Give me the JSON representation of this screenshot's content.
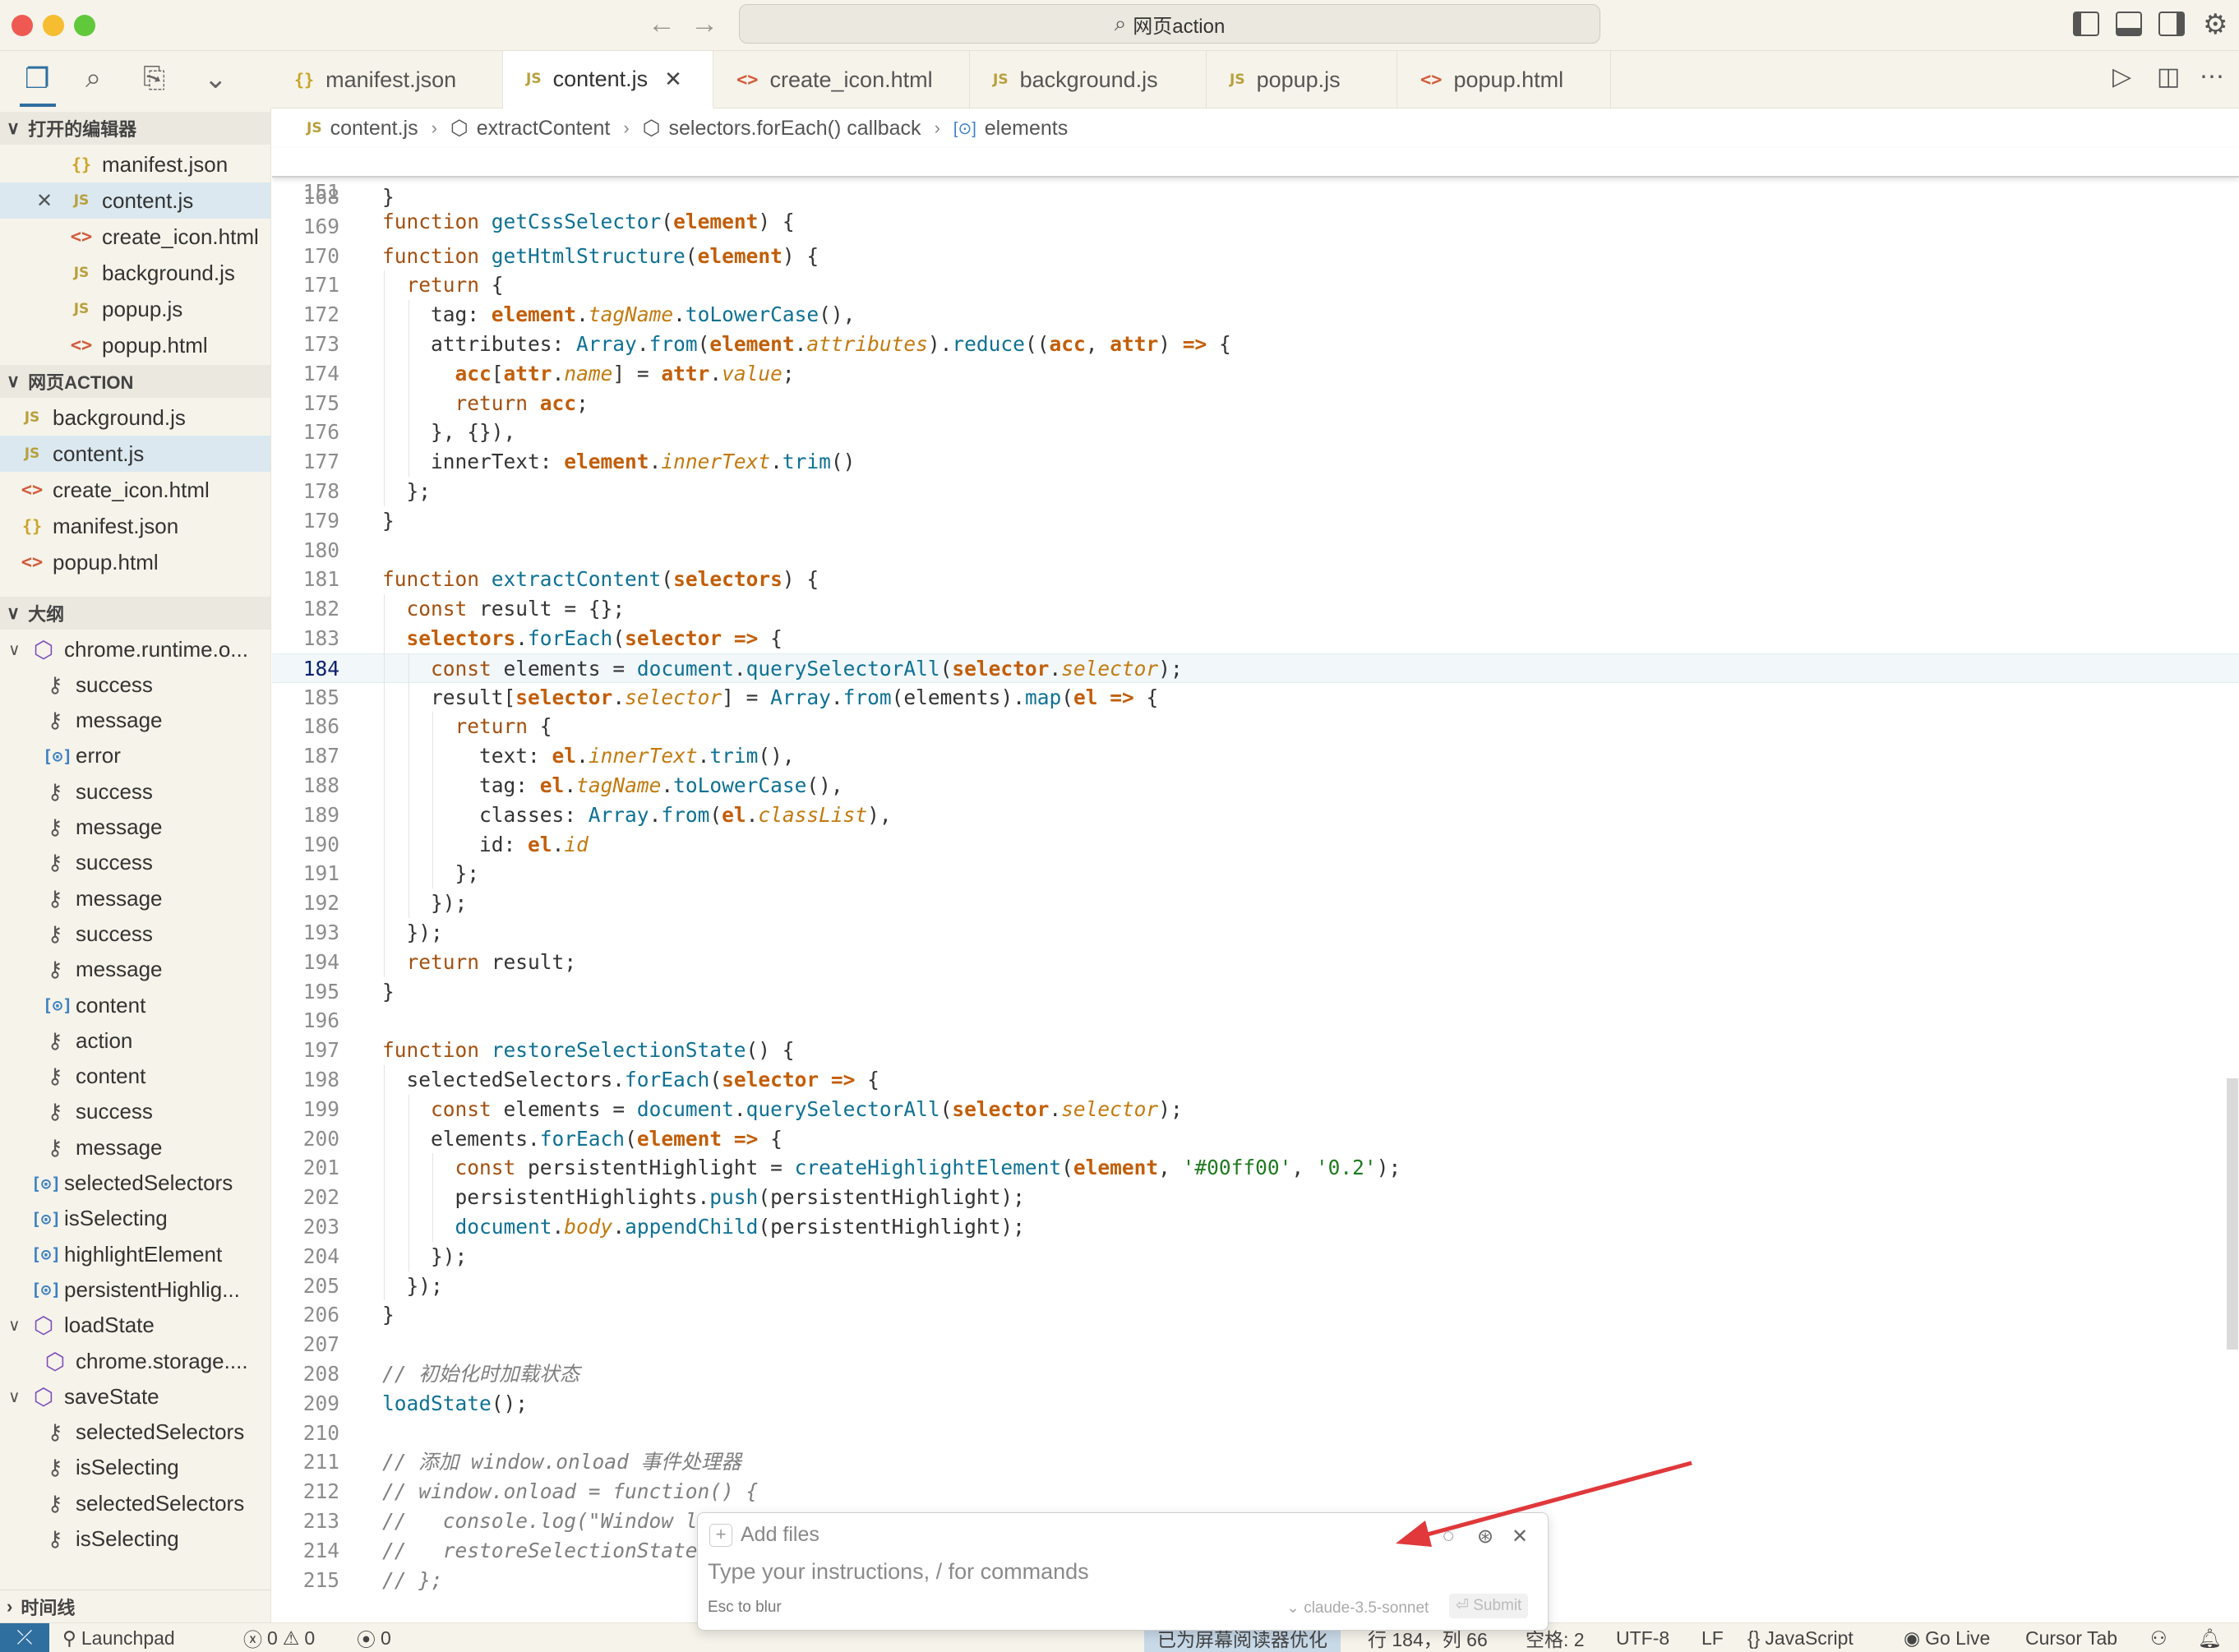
{
  "window": {
    "command_center": "网页action",
    "nav_back": "←",
    "nav_forward": "→"
  },
  "activity_bar": {
    "explorer": "❐",
    "search": "⌕",
    "scm": "⎘",
    "more": "⌄"
  },
  "tabs": [
    {
      "icon": "{}",
      "label": "manifest.json"
    },
    {
      "icon": "JS",
      "label": "content.js",
      "close": "✕"
    },
    {
      "icon": "<>",
      "label": "create_icon.html"
    },
    {
      "icon": "JS",
      "label": "background.js"
    },
    {
      "icon": "JS",
      "label": "popup.js"
    },
    {
      "icon": "<>",
      "label": "popup.html"
    }
  ],
  "tab_actions": {
    "run": "▷",
    "split": "◫",
    "more": "⋯"
  },
  "sidebar": {
    "open_editors_header": "打开的编辑器",
    "open_editors": [
      {
        "icon": "{}",
        "label": "manifest.json"
      },
      {
        "icon": "JS",
        "label": "content.js",
        "close": "✕"
      },
      {
        "icon": "<>",
        "label": "create_icon.html"
      },
      {
        "icon": "JS",
        "label": "background.js"
      },
      {
        "icon": "JS",
        "label": "popup.js"
      },
      {
        "icon": "<>",
        "label": "popup.html"
      }
    ],
    "project_header": "网页ACTION",
    "project_files": [
      {
        "icon": "JS",
        "label": "background.js"
      },
      {
        "icon": "JS",
        "label": "content.js"
      },
      {
        "icon": "<>",
        "label": "create_icon.html"
      },
      {
        "icon": "{}",
        "label": "manifest.json"
      },
      {
        "icon": "<>",
        "label": "popup.html"
      }
    ],
    "outline_header": "大纲",
    "outline": [
      {
        "kind": "module",
        "label": "chrome.runtime.o...",
        "chev": "∨"
      },
      {
        "kind": "key",
        "label": "success"
      },
      {
        "kind": "key",
        "label": "message"
      },
      {
        "kind": "var",
        "label": "error"
      },
      {
        "kind": "key",
        "label": "success"
      },
      {
        "kind": "key",
        "label": "message"
      },
      {
        "kind": "key",
        "label": "success"
      },
      {
        "kind": "key",
        "label": "message"
      },
      {
        "kind": "key",
        "label": "success"
      },
      {
        "kind": "key",
        "label": "message"
      },
      {
        "kind": "var",
        "label": "content"
      },
      {
        "kind": "key",
        "label": "action"
      },
      {
        "kind": "key",
        "label": "content"
      },
      {
        "kind": "key",
        "label": "success"
      },
      {
        "kind": "key",
        "label": "message"
      },
      {
        "kind": "var",
        "label": "selectedSelectors"
      },
      {
        "kind": "var",
        "label": "isSelecting"
      },
      {
        "kind": "var",
        "label": "highlightElement"
      },
      {
        "kind": "var",
        "label": "persistentHighlig..."
      },
      {
        "kind": "module",
        "label": "loadState",
        "chev": "∨"
      },
      {
        "kind": "module",
        "label": "chrome.storage...."
      },
      {
        "kind": "module",
        "label": "saveState",
        "chev": "∨"
      },
      {
        "kind": "key",
        "label": "selectedSelectors"
      },
      {
        "kind": "key",
        "label": "isSelecting"
      },
      {
        "kind": "key",
        "label": "selectedSelectors"
      },
      {
        "kind": "key",
        "label": "isSelecting"
      }
    ],
    "timeline_header": "时间线"
  },
  "breadcrumb": [
    {
      "icon": "JS",
      "label": "content.js"
    },
    {
      "icon": "⬡",
      "label": "extractContent"
    },
    {
      "icon": "⬡",
      "label": "selectors.forEach() callback"
    },
    {
      "icon": "[⊙]",
      "label": "elements"
    }
  ],
  "sticky_line": {
    "num": "151",
    "text": "function getCssSelector(element) {"
  },
  "code": {
    "current_line": 184,
    "lines": [
      {
        "n": "168",
        "t": "}"
      },
      {
        "n": "169",
        "t": ""
      },
      {
        "n": "170",
        "t": "function getHtmlStructure(element) {"
      },
      {
        "n": "171",
        "t": "  return {"
      },
      {
        "n": "172",
        "t": "    tag: element.tagName.toLowerCase(),"
      },
      {
        "n": "173",
        "t": "    attributes: Array.from(element.attributes).reduce((acc, attr) => {"
      },
      {
        "n": "174",
        "t": "      acc[attr.name] = attr.value;"
      },
      {
        "n": "175",
        "t": "      return acc;"
      },
      {
        "n": "176",
        "t": "    }, {}),"
      },
      {
        "n": "177",
        "t": "    innerText: element.innerText.trim()"
      },
      {
        "n": "178",
        "t": "  };"
      },
      {
        "n": "179",
        "t": "}"
      },
      {
        "n": "180",
        "t": ""
      },
      {
        "n": "181",
        "t": "function extractContent(selectors) {"
      },
      {
        "n": "182",
        "t": "  const result = {};"
      },
      {
        "n": "183",
        "t": "  selectors.forEach(selector => {"
      },
      {
        "n": "184",
        "t": "    const elements = document.querySelectorAll(selector.selector);"
      },
      {
        "n": "185",
        "t": "    result[selector.selector] = Array.from(elements).map(el => {"
      },
      {
        "n": "186",
        "t": "      return {"
      },
      {
        "n": "187",
        "t": "        text: el.innerText.trim(),"
      },
      {
        "n": "188",
        "t": "        tag: el.tagName.toLowerCase(),"
      },
      {
        "n": "189",
        "t": "        classes: Array.from(el.classList),"
      },
      {
        "n": "190",
        "t": "        id: el.id"
      },
      {
        "n": "191",
        "t": "      };"
      },
      {
        "n": "192",
        "t": "    });"
      },
      {
        "n": "193",
        "t": "  });"
      },
      {
        "n": "194",
        "t": "  return result;"
      },
      {
        "n": "195",
        "t": "}"
      },
      {
        "n": "196",
        "t": ""
      },
      {
        "n": "197",
        "t": "function restoreSelectionState() {"
      },
      {
        "n": "198",
        "t": "  selectedSelectors.forEach(selector => {"
      },
      {
        "n": "199",
        "t": "    const elements = document.querySelectorAll(selector.selector);"
      },
      {
        "n": "200",
        "t": "    elements.forEach(element => {"
      },
      {
        "n": "201",
        "t": "      const persistentHighlight = createHighlightElement(element, '#00ff00', '0.2');"
      },
      {
        "n": "202",
        "t": "      persistentHighlights.push(persistentHighlight);"
      },
      {
        "n": "203",
        "t": "      document.body.appendChild(persistentHighlight);"
      },
      {
        "n": "204",
        "t": "    });"
      },
      {
        "n": "205",
        "t": "  });"
      },
      {
        "n": "206",
        "t": "}"
      },
      {
        "n": "207",
        "t": ""
      },
      {
        "n": "208",
        "t": "// 初始化时加载状态"
      },
      {
        "n": "209",
        "t": "loadState();"
      },
      {
        "n": "210",
        "t": ""
      },
      {
        "n": "211",
        "t": "// 添加 window.onload 事件处理器"
      },
      {
        "n": "212",
        "t": "// window.onload = function() {"
      },
      {
        "n": "213",
        "t": "//   console.log(\"Window lo"
      },
      {
        "n": "214",
        "t": "//   restoreSelectionState"
      },
      {
        "n": "215",
        "t": "// };"
      }
    ]
  },
  "chat": {
    "add_files": "Add files",
    "input_placeholder": "Type your instructions, / for commands",
    "esc_hint": "Esc to blur",
    "model": "⌄ claude-3.5-sonnet",
    "submit": "⏎ Submit",
    "icon_history": "◌",
    "icon_settings": "⊛",
    "icon_close": "✕"
  },
  "statusbar": {
    "remote": "⤫",
    "launchpad": "Launchpad",
    "errors": "0",
    "warnings": "0",
    "ports": "0",
    "screen_reader": "已为屏幕阅读器优化",
    "cursor": "行 184，列 66",
    "spaces": "空格: 2",
    "encoding": "UTF-8",
    "eol": "LF",
    "language": "JavaScript",
    "golive": "Go Live",
    "cursortab": "Cursor Tab"
  },
  "colors": {
    "accent": "#2f6f9f",
    "annotation_arrow": "#e0383b",
    "sidebar_bg": "#f6f3ea",
    "selection_bg": "#dbe8f0"
  }
}
